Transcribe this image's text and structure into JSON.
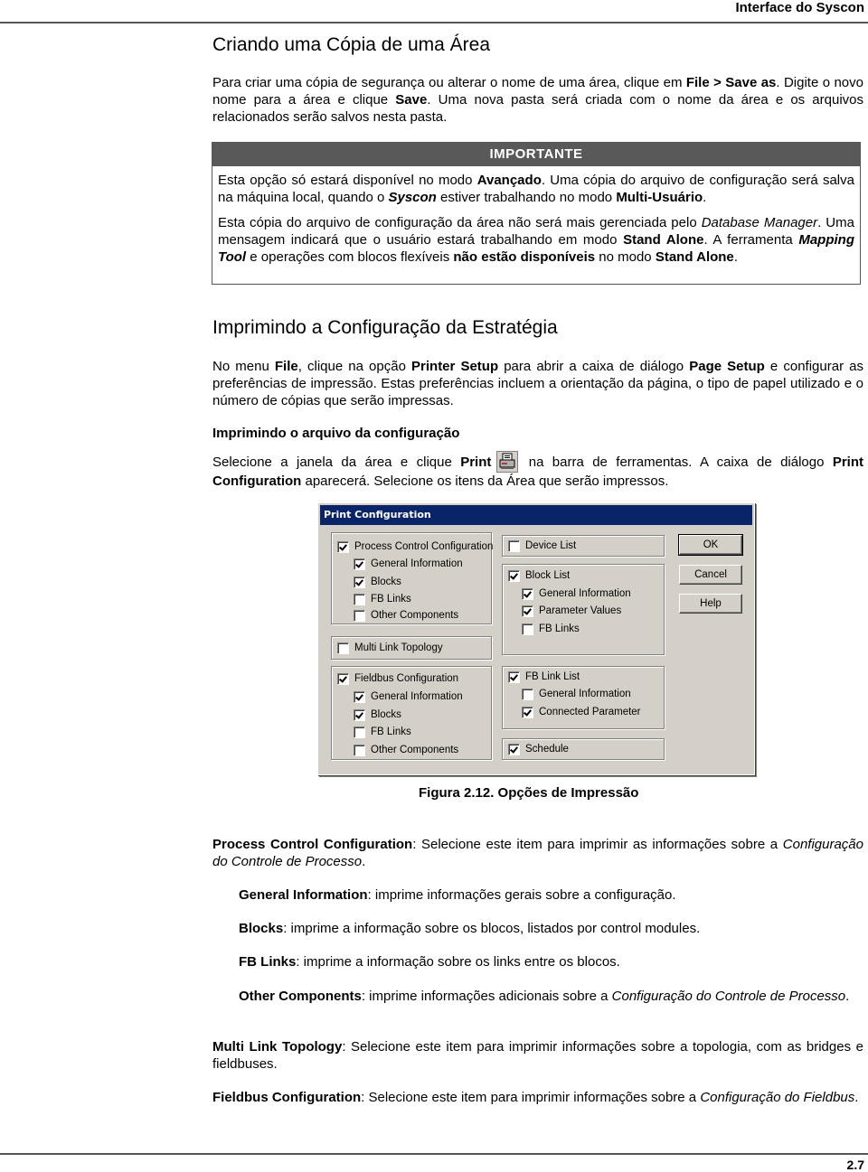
{
  "header": {
    "running_title": "Interface do Syscon"
  },
  "section1": {
    "title": "Criando uma Cópia de uma Área",
    "para": {
      "t1": "Para criar uma cópia de segurança ou alterar o nome de uma área, clique em ",
      "b1": "File > Save as",
      "t2": ". Digite o novo nome para a área e clique ",
      "b2": "Save",
      "t3": ". Uma nova pasta será criada com o nome da área e os arquivos relacionados serão salvos nesta pasta."
    },
    "important": {
      "heading": "IMPORTANTE",
      "p1": {
        "t1": "Esta opção só estará disponível no modo ",
        "b1": "Avançado",
        "t2": ". Uma cópia do arquivo de configuração será salva na máquina local, quando o ",
        "bi1": "Syscon",
        "t3": " estiver trabalhando no modo ",
        "b2": "Multi-Usuário",
        "t4": "."
      },
      "p2": {
        "t1": "Esta cópia do arquivo de configuração da área não será mais gerenciada pelo ",
        "i1": "Database Manager",
        "t2": ". Uma mensagem indicará que o usuário estará trabalhando em modo ",
        "b1": "Stand Alone",
        "t3": ". A ferramenta ",
        "bi1": "Mapping Tool",
        "t4": " e operações com blocos flexíveis ",
        "b2": "não estão disponíveis",
        "t5": " no modo ",
        "b3": "Stand Alone",
        "t6": "."
      }
    }
  },
  "section2": {
    "title": "Imprimindo a Configuração da Estratégia",
    "para": {
      "t1": "No menu ",
      "b1": "File",
      "t2": ", clique na opção ",
      "b2": "Printer Setup",
      "t3": " para abrir a caixa de diálogo ",
      "b3": "Page Setup",
      "t4": " e configurar as preferências de impressão. Estas preferências incluem a orientação da página, o tipo de papel utilizado e o número de cópias que serão impressas."
    },
    "subtitle": "Imprimindo o arquivo da configuração",
    "para2": {
      "t1": "Selecione a janela da área e clique ",
      "b1": "Print",
      "icon": "printer-icon",
      "t2": " na barra de ferramentas. A caixa de diálogo ",
      "b2": "Print Configuration",
      "t3": " aparecerá. Selecione os itens da Área que serão impressos."
    }
  },
  "dialog": {
    "title": "Print Configuration",
    "left_groups": [
      {
        "items": [
          {
            "label": "Process Control Configuration",
            "checked": true
          },
          {
            "label": "General Information",
            "checked": true
          },
          {
            "label": "Blocks",
            "checked": true
          },
          {
            "label": "FB Links",
            "checked": false
          },
          {
            "label": "Other Components",
            "checked": false
          }
        ]
      },
      {
        "items": [
          {
            "label": "Multi Link Topology",
            "checked": false
          }
        ]
      },
      {
        "items": [
          {
            "label": "Fieldbus Configuration",
            "checked": true
          },
          {
            "label": "General Information",
            "checked": true
          },
          {
            "label": "Blocks",
            "checked": true
          },
          {
            "label": "FB Links",
            "checked": false
          },
          {
            "label": "Other Components",
            "checked": false
          }
        ]
      }
    ],
    "right_groups": [
      {
        "items": [
          {
            "label": "Device List",
            "checked": false
          }
        ]
      },
      {
        "items": [
          {
            "label": "Block List",
            "checked": true
          },
          {
            "label": "General Information",
            "checked": true
          },
          {
            "label": "Parameter Values",
            "checked": true
          },
          {
            "label": "FB Links",
            "checked": false
          }
        ]
      },
      {
        "items": [
          {
            "label": "FB Link List",
            "checked": true
          },
          {
            "label": "General Information",
            "checked": false
          },
          {
            "label": "Connected Parameter",
            "checked": true
          }
        ]
      },
      {
        "items": [
          {
            "label": "Schedule",
            "checked": true
          }
        ]
      }
    ],
    "buttons": {
      "ok": "OK",
      "cancel": "Cancel",
      "help": "Help"
    }
  },
  "figure_caption": "Figura 2.12. Opções de Impressão",
  "descriptions": {
    "pcc": {
      "b": "Process Control Configuration",
      "t1": ": Selecione este item para imprimir as informações sobre a ",
      "i": "Configuração do Controle de Processo",
      "t2": "."
    },
    "gi": {
      "b": "General Information",
      "t1": ": imprime informações gerais sobre a configuração."
    },
    "blocks": {
      "b": "Blocks",
      "t1": ": imprime a informação sobre os blocos, listados por control modules."
    },
    "fblinks": {
      "b": "FB Links",
      "t1": ": imprime a informação sobre os links entre os blocos."
    },
    "other": {
      "b": "Other Components",
      "t1": ": imprime informações adicionais sobre a ",
      "i": "Configuração do Controle de Processo",
      "t2": "."
    },
    "mlt": {
      "b": "Multi Link Topology",
      "t1": ": Selecione este item para imprimir informações sobre a topologia, com as bridges e fieldbuses."
    },
    "fc": {
      "b": "Fieldbus Configuration",
      "t1": ": Selecione este item para imprimir informações sobre a ",
      "i": "Configuração do Fieldbus",
      "t2": "."
    }
  },
  "footer": {
    "page_number": "2.7"
  }
}
